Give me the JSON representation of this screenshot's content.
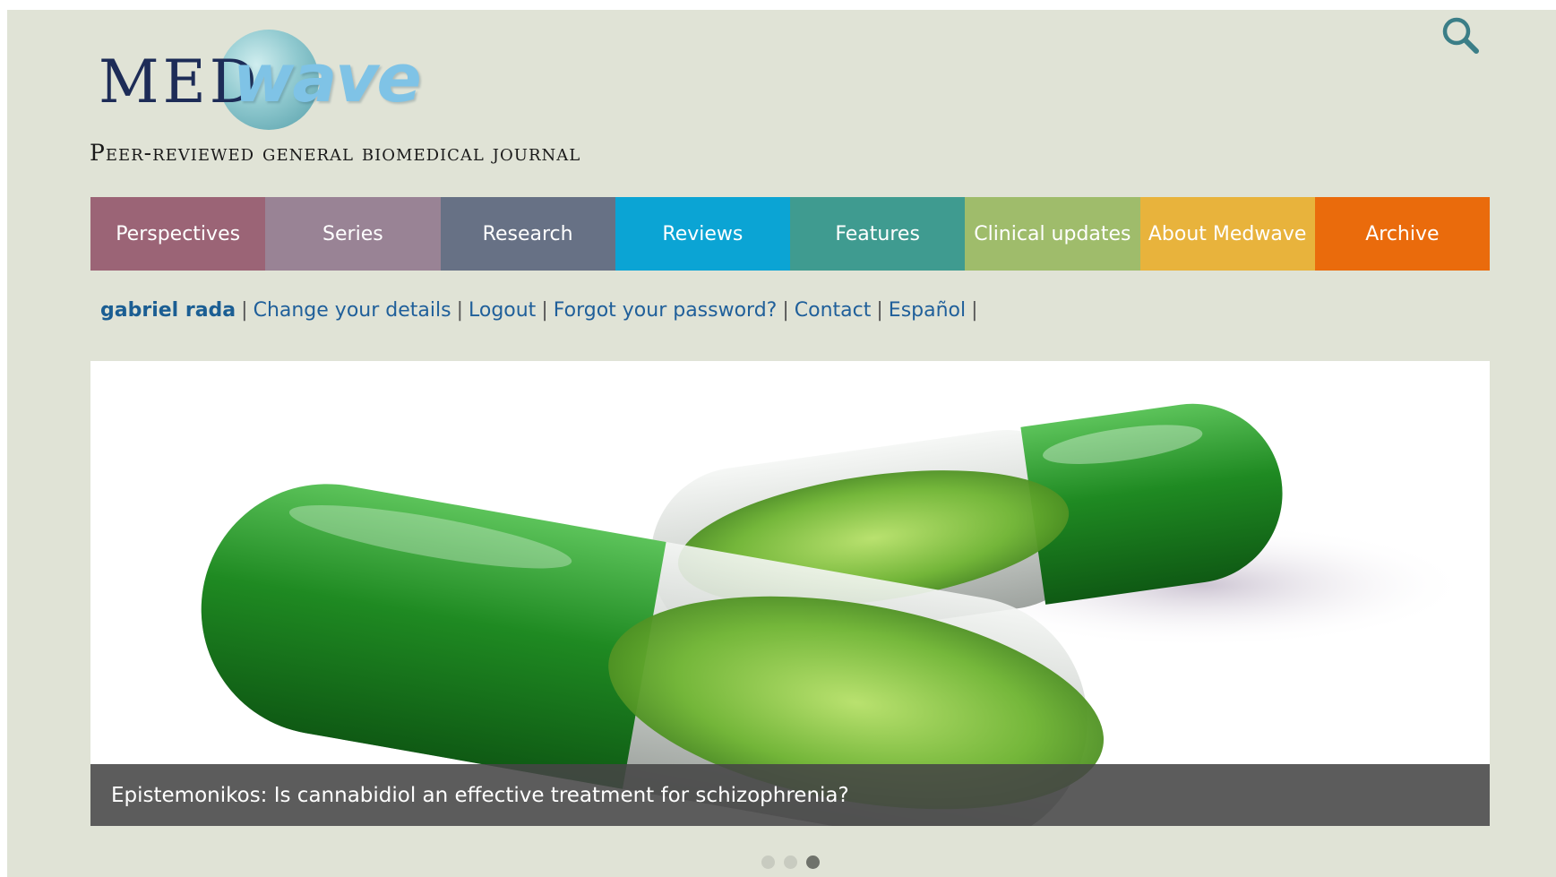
{
  "logo": {
    "part1": "MED",
    "part2": "wave"
  },
  "tagline": "Peer-reviewed general biomedical journal",
  "search": {
    "icon": "search-icon"
  },
  "nav": [
    {
      "label": "Perspectives",
      "color": "#9b6476"
    },
    {
      "label": "Series",
      "color": "#998395"
    },
    {
      "label": "Research",
      "color": "#677185"
    },
    {
      "label": "Reviews",
      "color": "#0ba4d4"
    },
    {
      "label": "Features",
      "color": "#3f9b90"
    },
    {
      "label": "Clinical updates",
      "color": "#9fbc6b"
    },
    {
      "label": "About Medwave",
      "color": "#e8b33c"
    },
    {
      "label": "Archive",
      "color": "#ea6b0c"
    }
  ],
  "user": {
    "name": "gabriel rada",
    "links": [
      "Change your details",
      "Logout",
      "Forgot your password?",
      "Contact",
      "Español"
    ],
    "separator": "|"
  },
  "slider": {
    "caption": "Epistemonikos: Is cannabidiol an effective treatment for schizophrenia?",
    "slide_count": 3,
    "active_slide": 3
  }
}
